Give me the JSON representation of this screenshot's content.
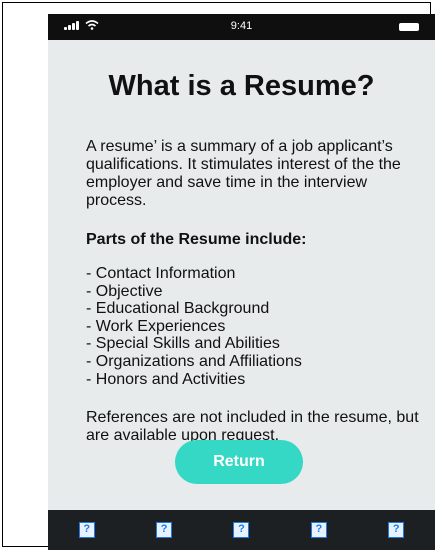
{
  "status_bar": {
    "time": "9:41"
  },
  "page": {
    "title": "What is a Resume?",
    "intro": "A resume’ is a summary of a job applicant’s qualifications. It stimulates interest of the the employer and save time in the interview process.",
    "parts_heading": "Parts of the Resume include:",
    "parts": [
      "Contact Information",
      "Objective",
      "Educational Background",
      "Work Experiences",
      "Special Skills and Abilities",
      "Organizations and Affiliations",
      "Honors and Activities"
    ],
    "note": " References are not included in  the resume, but are available upon request.",
    "return_label": "Return"
  },
  "tab_bar": {
    "items": [
      {
        "icon": "help-icon",
        "glyph": "?"
      },
      {
        "icon": "help-icon",
        "glyph": "?"
      },
      {
        "icon": "help-icon",
        "glyph": "?"
      },
      {
        "icon": "help-icon",
        "glyph": "?"
      },
      {
        "icon": "help-icon",
        "glyph": "?"
      }
    ]
  },
  "colors": {
    "background": "#e7ebec",
    "status_bar": "#0f0f0f",
    "button": "#34d8c4",
    "tab_bar": "#1d2023",
    "icon_blue": "#1e7be3"
  }
}
